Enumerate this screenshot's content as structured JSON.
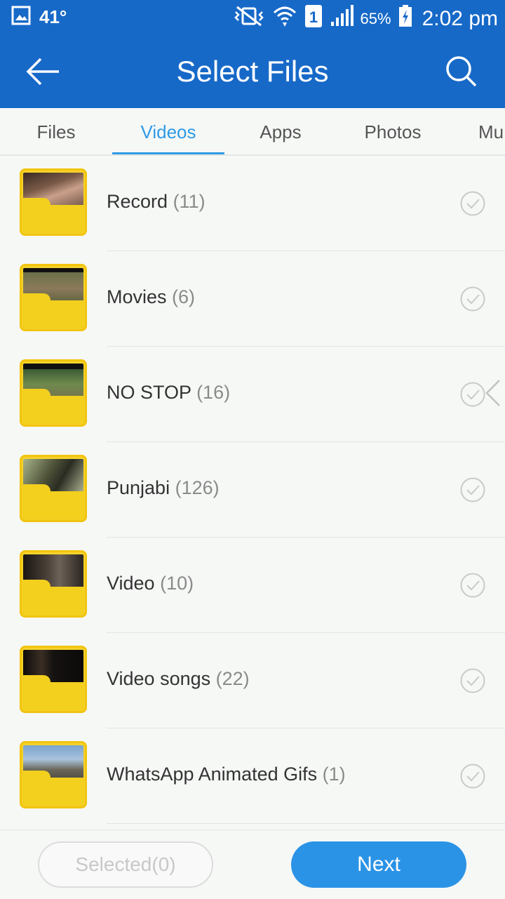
{
  "status_bar": {
    "temperature": "41°",
    "sim_slot": "1",
    "battery": "65%",
    "time": "2:02 pm"
  },
  "header": {
    "title": "Select Files"
  },
  "tabs": [
    {
      "label": "Files",
      "active": false
    },
    {
      "label": "Videos",
      "active": true
    },
    {
      "label": "Apps",
      "active": false
    },
    {
      "label": "Photos",
      "active": false
    },
    {
      "label": "Mu",
      "active": false
    }
  ],
  "folders": [
    {
      "name": "Record",
      "count": "(11)"
    },
    {
      "name": "Movies",
      "count": "(6)"
    },
    {
      "name": "NO STOP",
      "count": "(16)"
    },
    {
      "name": "Punjabi",
      "count": "(126)"
    },
    {
      "name": "Video",
      "count": "(10)"
    },
    {
      "name": "Video songs",
      "count": "(22)"
    },
    {
      "name": "WhatsApp Animated Gifs",
      "count": "(1)"
    }
  ],
  "footer": {
    "selected_label": "Selected(0)",
    "next_label": "Next"
  },
  "colors": {
    "primary": "#1769c8",
    "accent": "#2f9ae6",
    "folder_yellow": "#f5d22a",
    "next_button": "#2b93e6"
  }
}
